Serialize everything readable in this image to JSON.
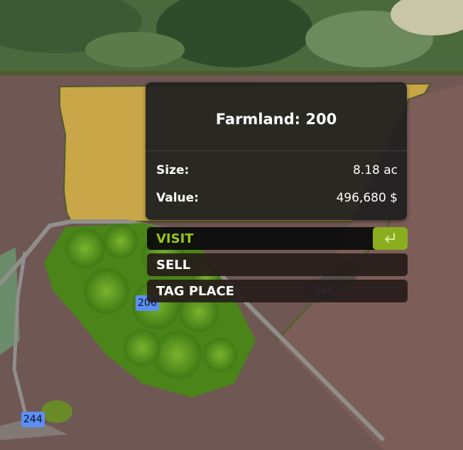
{
  "map": {
    "field_tags": [
      {
        "id": "tag-206",
        "label": "206"
      },
      {
        "id": "tag-248",
        "label": "248"
      },
      {
        "id": "tag-244",
        "label": "244"
      }
    ]
  },
  "farmland_card": {
    "title": "Farmland: 200",
    "size_label": "Size:",
    "size_value": "8.18 ac",
    "value_label": "Value:",
    "value_value": "496,680 $"
  },
  "actions": {
    "visit": "VISIT",
    "sell": "SELL",
    "tag_place": "TAG PLACE",
    "confirm_key_icon": "enter-key-icon"
  },
  "colors": {
    "accent": "#9dc21a",
    "key_background": "#8aae1e",
    "owned_field": "#c9a647",
    "tag_active": "#5b8ff2"
  }
}
